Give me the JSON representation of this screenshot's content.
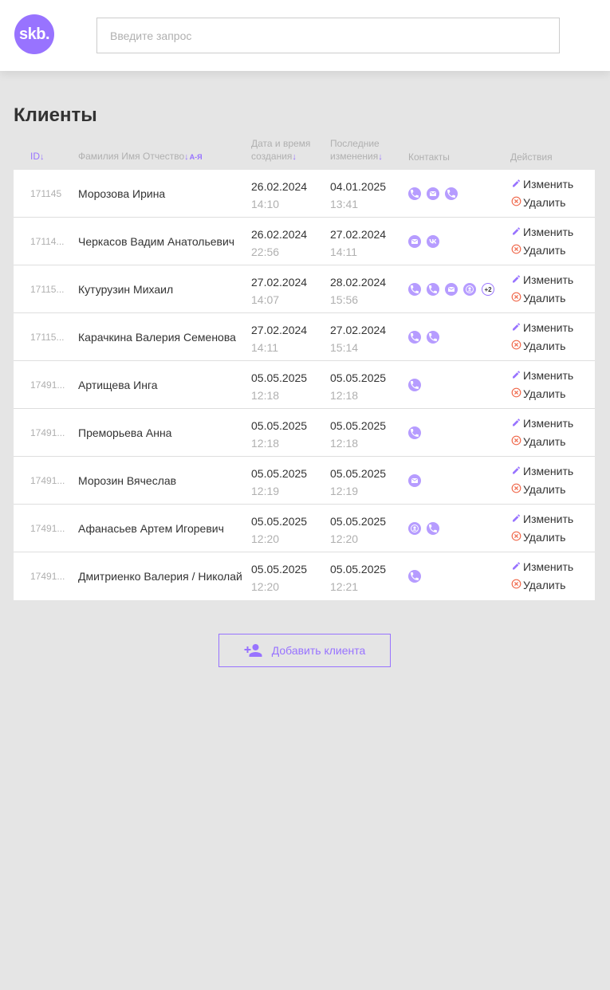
{
  "header": {
    "logo_text": "skb.",
    "search_placeholder": "Введите запрос"
  },
  "page": {
    "title": "Клиенты"
  },
  "table": {
    "headers": {
      "id": "ID",
      "fio": "Фамилия Имя Отчество",
      "fio_sort": "А-Я",
      "created_line1": "Дата и время",
      "created_line2": "создания",
      "updated_line1": "Последние",
      "updated_line2": "изменения",
      "contacts": "Контакты",
      "actions": "Действия"
    },
    "edit_label": "Изменить",
    "delete_label": "Удалить",
    "rows": [
      {
        "id": "171145",
        "name": "Морозова Ирина",
        "created_date": "26.02.2024",
        "created_time": "14:10",
        "updated_date": "04.01.2025",
        "updated_time": "13:41",
        "contacts": [
          "phone",
          "mail",
          "phone"
        ],
        "more": ""
      },
      {
        "id": "17114...",
        "name": "Черкасов Вадим Анатольевич",
        "created_date": "26.02.2024",
        "created_time": "22:56",
        "updated_date": "27.02.2024",
        "updated_time": "14:11",
        "contacts": [
          "mail",
          "vk"
        ],
        "more": ""
      },
      {
        "id": "17115...",
        "name": "Кутурузин Михаил",
        "created_date": "27.02.2024",
        "created_time": "14:07",
        "updated_date": "28.02.2024",
        "updated_time": "15:56",
        "contacts": [
          "phone",
          "phone",
          "mail",
          "user"
        ],
        "more": "+2"
      },
      {
        "id": "17115...",
        "name": "Карачкина Валерия Семенова",
        "created_date": "27.02.2024",
        "created_time": "14:11",
        "updated_date": "27.02.2024",
        "updated_time": "15:14",
        "contacts": [
          "phone",
          "phone"
        ],
        "more": ""
      },
      {
        "id": "17491...",
        "name": "Артищева Инга",
        "created_date": "05.05.2025",
        "created_time": "12:18",
        "updated_date": "05.05.2025",
        "updated_time": "12:18",
        "contacts": [
          "phone"
        ],
        "more": ""
      },
      {
        "id": "17491...",
        "name": "Преморьева Анна",
        "created_date": "05.05.2025",
        "created_time": "12:18",
        "updated_date": "05.05.2025",
        "updated_time": "12:18",
        "contacts": [
          "phone"
        ],
        "more": ""
      },
      {
        "id": "17491...",
        "name": "Морозин Вячеслав",
        "created_date": "05.05.2025",
        "created_time": "12:19",
        "updated_date": "05.05.2025",
        "updated_time": "12:19",
        "contacts": [
          "mail"
        ],
        "more": ""
      },
      {
        "id": "17491...",
        "name": "Афанасьев Артем Игоревич",
        "created_date": "05.05.2025",
        "created_time": "12:20",
        "updated_date": "05.05.2025",
        "updated_time": "12:20",
        "contacts": [
          "user",
          "phone"
        ],
        "more": ""
      },
      {
        "id": "17491...",
        "name": "Дмитриенко Валерия / Николай",
        "created_date": "05.05.2025",
        "created_time": "12:20",
        "updated_date": "05.05.2025",
        "updated_time": "12:21",
        "contacts": [
          "phone"
        ],
        "more": ""
      }
    ]
  },
  "add_button": {
    "label": "Добавить клиента"
  },
  "colors": {
    "accent": "#9873ff",
    "delete": "#f06a4d",
    "muted": "#b0b0b0",
    "text": "#333333"
  }
}
